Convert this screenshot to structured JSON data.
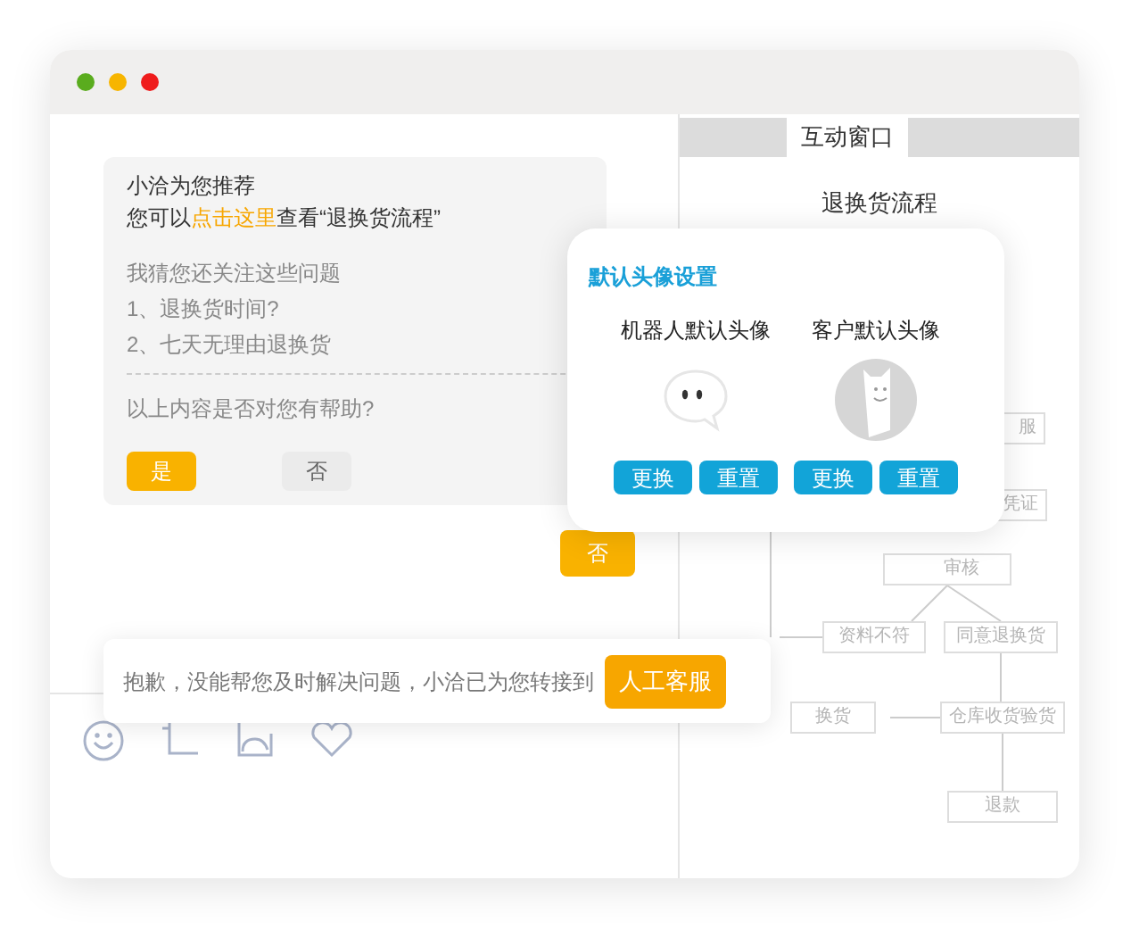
{
  "window": {
    "dots": [
      {
        "color": "#5aac1e"
      },
      {
        "color": "#f7b500"
      },
      {
        "color": "#ef1c1c"
      }
    ]
  },
  "chat": {
    "bubble": {
      "title": "小洽为您推荐",
      "line_before": "您可以",
      "link": "点击这里",
      "line_after": "查看“退换货流程”",
      "suggest_heading": "我猜您还关注这些问题",
      "questions": [
        "1、退换货时间?",
        "2、七天无理由退换货"
      ],
      "helpful_prompt": "以上内容是否对您有帮助?",
      "buttons": [
        {
          "label": "是",
          "selected": true
        },
        {
          "label": "否",
          "selected": false
        }
      ]
    },
    "reply": "否",
    "notice": {
      "text": "抱歉，没能帮您及时解决问题，小洽已为您转接到",
      "button": "人工客服"
    }
  },
  "panel": {
    "tabs": [
      {
        "label": "互动窗口",
        "selected": true
      }
    ],
    "flow_title": "退换货流程",
    "flow_nodes": [
      {
        "label": "服"
      },
      {
        "label": "凭证"
      },
      {
        "label": "审核"
      },
      {
        "label": "资料不符"
      },
      {
        "label": "同意退换货"
      },
      {
        "label": "换货"
      },
      {
        "label": "仓库收货验货"
      },
      {
        "label": "退款"
      }
    ]
  },
  "avatar_settings": {
    "title": "默认头像设置",
    "avatars": [
      {
        "kind": "robot",
        "label": "机器人默认头像",
        "buttons": [
          "更换",
          "重置"
        ]
      },
      {
        "kind": "customer",
        "label": "客户默认头像",
        "buttons": [
          "更换",
          "重置"
        ]
      }
    ]
  }
}
